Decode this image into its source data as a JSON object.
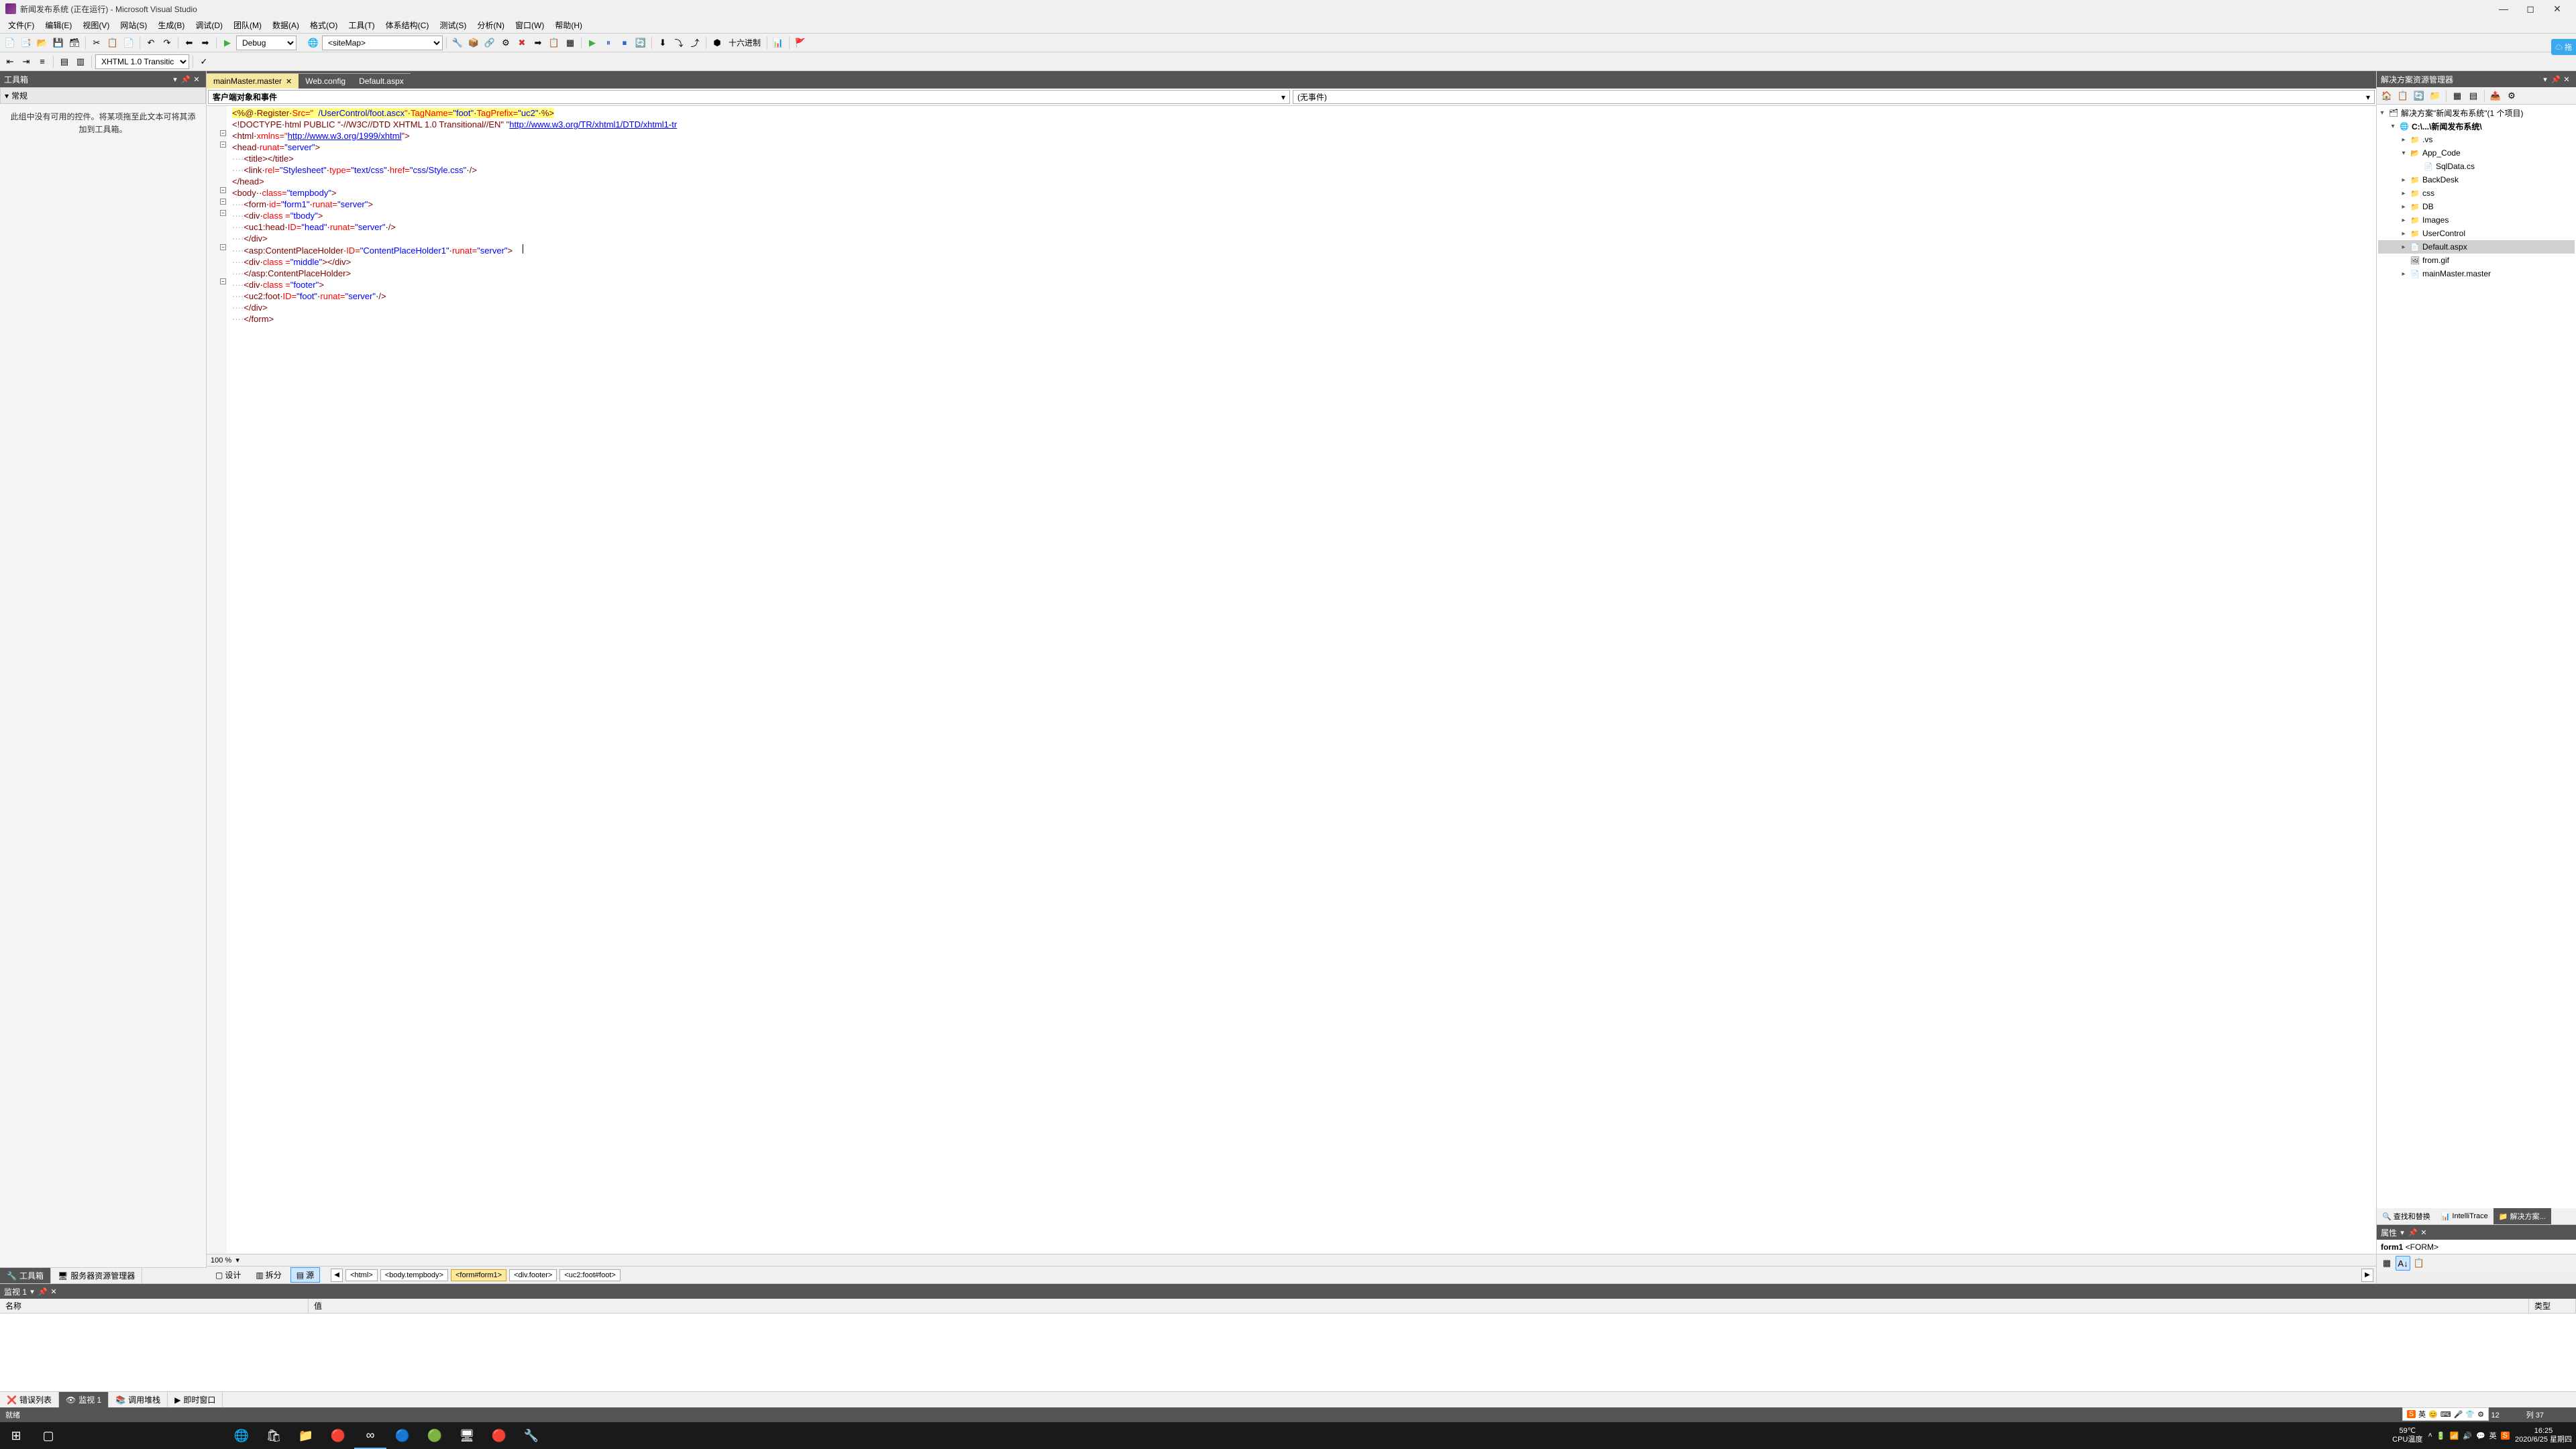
{
  "title": "新闻发布系统 (正在运行) - Microsoft Visual Studio",
  "menu": [
    "文件(F)",
    "编辑(E)",
    "视图(V)",
    "网站(S)",
    "生成(B)",
    "调试(D)",
    "团队(M)",
    "数据(A)",
    "格式(O)",
    "工具(T)",
    "体系结构(C)",
    "测试(S)",
    "分析(N)",
    "窗口(W)",
    "帮助(H)"
  ],
  "toolbar": {
    "config": "Debug",
    "target": "<siteMap>",
    "hex": "十六进制"
  },
  "toolbar2": {
    "doctype": "XHTML 1.0 Transitic"
  },
  "toolbox": {
    "title": "工具箱",
    "section": "常规",
    "empty": "此组中没有可用的控件。将某项拖至此文本可将其添加到工具箱。"
  },
  "left_tabs": {
    "toolbox": "工具箱",
    "server": "服务器资源管理器"
  },
  "doc_tabs": [
    {
      "label": "mainMaster.master",
      "active": true
    },
    {
      "label": "Web.config",
      "active": false
    },
    {
      "label": "Default.aspx",
      "active": false
    }
  ],
  "editor_dd": {
    "left": "客户端对象和事件",
    "right": "(无事件)"
  },
  "code": {
    "l1_pre": "<%@",
    "l1_reg": "Register",
    "l1_src": "Src=\"",
    "l1_srcv": "  /UserControl/foot.ascx",
    "l1_tn": "TagName=",
    "l1_tnv": "\"foot\"",
    "l1_tp": "TagPrefix=",
    "l1_tpv": "\"uc2\"",
    "l1_end": "%>",
    "l2_a": "<!DOCTYPE",
    "l2_b": "html PUBLIC \"-//W3C//DTD XHTML 1.0 Transitional//EN\" \"",
    "l2_url": "http://www.w3.org/TR/xhtml1/DTD/xhtml1-tr",
    "l3_a": "<html",
    "l3_b": "xmlns=\"",
    "l3_url": "http://www.w3.org/1999/xhtml",
    "l3_c": "\">",
    "l4": "<head runat=\"server\">",
    "l5": "<title></title>",
    "l6": "<link rel=\"Stylesheet\" type=\"text/css\" href=\"css/Style.css\" />",
    "l7": "</head>",
    "l8": "<body  class=\"tempbody\">",
    "l9": "<form id=\"form1\" runat=\"server\">",
    "l10": "<div class =\"tbody\">",
    "l11": "<uc1:head ID=\"head\" runat=\"server\" />",
    "l12": "</div>",
    "l13": "<asp:ContentPlaceHolder ID=\"ContentPlaceHolder1\" runat=\"server\">",
    "l14": "<div class =\"middle\"></div>",
    "l15": "</asp:ContentPlaceHolder>",
    "l16": "<div class =\"footer\">",
    "l17": "<uc2:foot ID=\"foot\" runat=\"server\" />",
    "l18": "</div>",
    "l19": "</form>"
  },
  "zoom": "100 %",
  "view_buttons": {
    "design": "设计",
    "split": "拆分",
    "source": "源"
  },
  "path": [
    "<html>",
    "<body.tempbody>",
    "<form#form1>",
    "<div.footer>",
    "<uc2:foot#foot>"
  ],
  "solution": {
    "title": "解决方案资源管理器",
    "root": "解决方案\"新闻发布系统\"(1 个项目)",
    "project": "C:\\...\\新闻发布系统\\",
    "items": [
      {
        "name": ".vs",
        "type": "folder",
        "indent": 2
      },
      {
        "name": "App_Code",
        "type": "folder",
        "indent": 2,
        "expanded": true
      },
      {
        "name": "SqlData.cs",
        "type": "cs",
        "indent": 3
      },
      {
        "name": "BackDesk",
        "type": "folder",
        "indent": 2
      },
      {
        "name": "css",
        "type": "folder",
        "indent": 2
      },
      {
        "name": "DB",
        "type": "folder",
        "indent": 2
      },
      {
        "name": "Images",
        "type": "folder",
        "indent": 2
      },
      {
        "name": "UserControl",
        "type": "folder",
        "indent": 2
      },
      {
        "name": "Default.aspx",
        "type": "aspx",
        "indent": 2,
        "selected": true
      },
      {
        "name": "from.gif",
        "type": "img",
        "indent": 2
      },
      {
        "name": "mainMaster.master",
        "type": "master",
        "indent": 2
      }
    ]
  },
  "right_tabs": {
    "find": "查找和替换",
    "intelli": "IntelliTrace",
    "sol": "解决方案..."
  },
  "props": {
    "title": "属性",
    "obj": "form1 <FORM>"
  },
  "monitor": {
    "title": "监视 1",
    "cols": {
      "name": "名称",
      "value": "值",
      "type": "类型"
    },
    "tabs": {
      "errors": "错误列表",
      "watch": "监视 1",
      "callstack": "调用堆栈",
      "immediate": "即时窗口"
    }
  },
  "status": {
    "ready": "就绪",
    "line": "行 12",
    "col": "列 37"
  },
  "taskbar": {
    "temp": "59℃",
    "cpu": "CPU温度",
    "ime_lang": "英",
    "time": "16:25",
    "date": "2020/6/25 星期四"
  },
  "ime_float": {
    "brand": "S",
    "lang": "英"
  },
  "cloud": "拖"
}
